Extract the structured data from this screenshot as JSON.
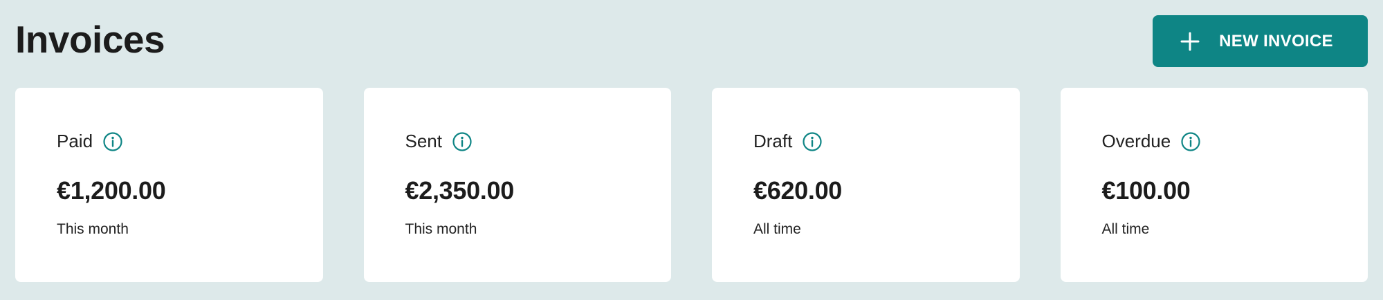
{
  "header": {
    "title": "Invoices",
    "new_invoice_label": "NEW INVOICE",
    "new_invoice_icon": "plus-icon"
  },
  "cards": [
    {
      "label": "Paid",
      "amount": "€1,200.00",
      "period": "This month",
      "icon": "info-icon"
    },
    {
      "label": "Sent",
      "amount": "€2,350.00",
      "period": "This month",
      "icon": "info-icon"
    },
    {
      "label": "Draft",
      "amount": "€620.00",
      "period": "All time",
      "icon": "info-icon"
    },
    {
      "label": "Overdue",
      "amount": "€100.00",
      "period": "All time",
      "icon": "info-icon"
    }
  ],
  "colors": {
    "background": "#dde9ea",
    "accent": "#0e8585",
    "card": "#ffffff",
    "text": "#1c1c1c"
  }
}
